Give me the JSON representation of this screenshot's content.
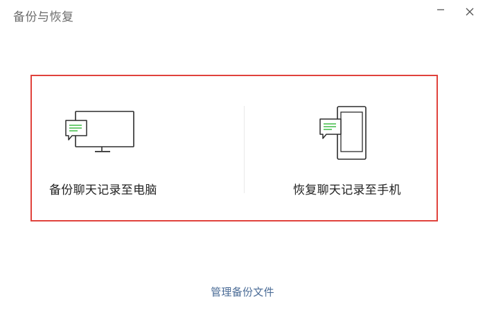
{
  "window": {
    "title": "备份与恢复",
    "minimize_icon": "minimize-icon",
    "close_icon": "close-icon"
  },
  "options": {
    "backup_label": "备份聊天记录至电脑",
    "backup_icon": "monitor-chat-icon",
    "restore_label": "恢复聊天记录至手机",
    "restore_icon": "phone-chat-icon"
  },
  "footer": {
    "manage_link": "管理备份文件"
  },
  "colors": {
    "highlight_border": "#e0413b",
    "link": "#4a6b96",
    "chat_green": "#3ebc45"
  }
}
